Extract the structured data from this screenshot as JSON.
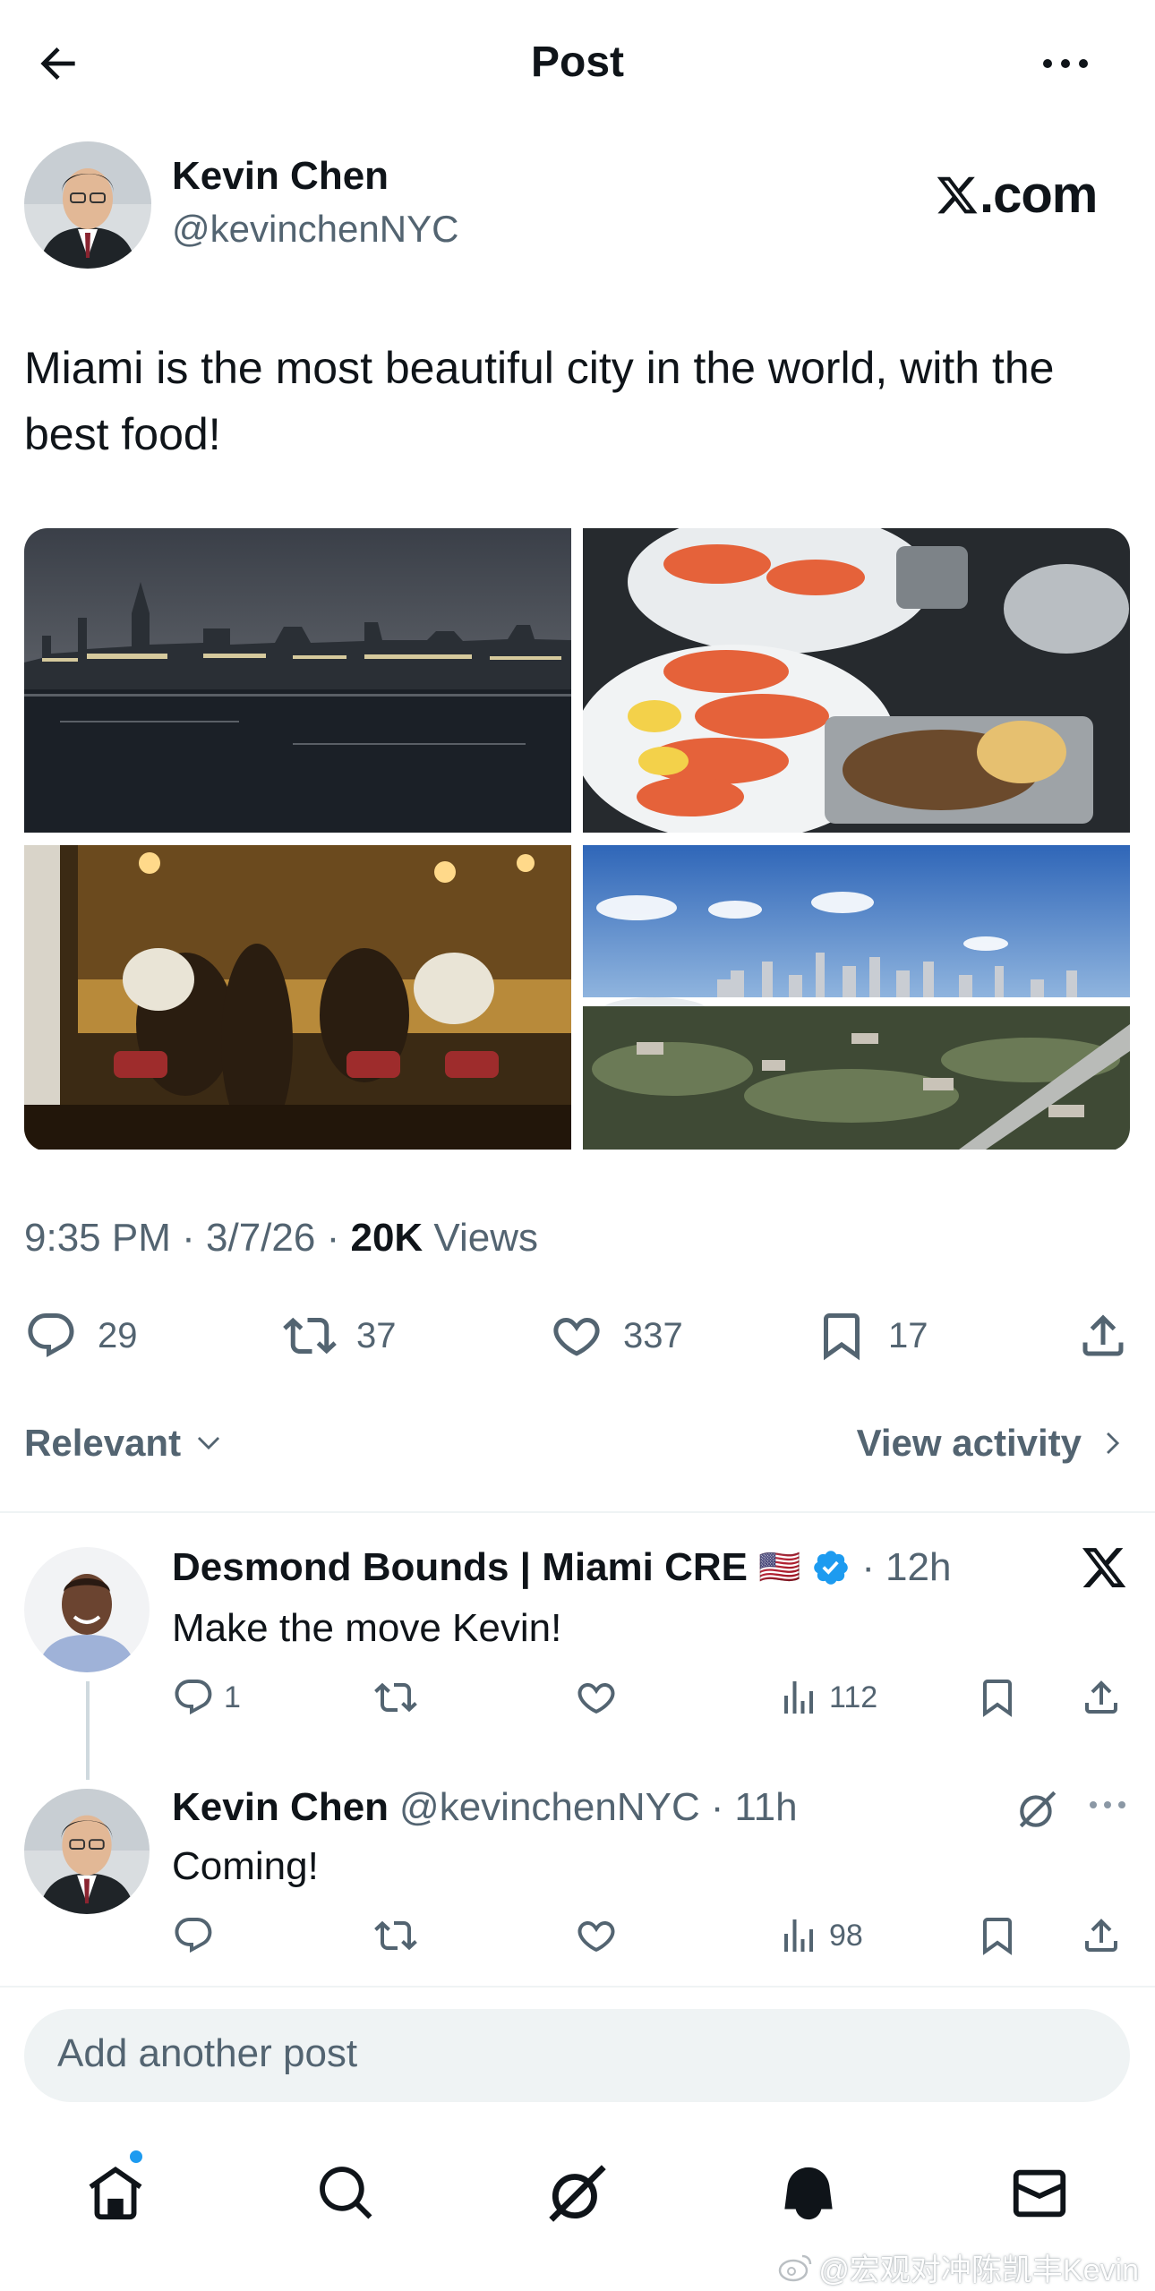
{
  "header": {
    "title": "Post"
  },
  "post": {
    "author_name": "Kevin Chen",
    "author_handle": "@kevinchenNYC",
    "brand_logo_text": ".com",
    "text": "Miami is the most beautiful city in the world, with the best food!",
    "time": "9:35 PM",
    "date": "3/7/26",
    "views_count": "20K",
    "views_label": "Views",
    "separator": "·",
    "stats": {
      "replies": "29",
      "reposts": "37",
      "likes": "337",
      "bookmarks": "17"
    },
    "media": [
      {
        "name": "miami-night-skyline"
      },
      {
        "name": "stone-crab-dinner"
      },
      {
        "name": "restaurant-bar-scene"
      },
      {
        "name": "miami-aerial-view"
      }
    ]
  },
  "sort": {
    "label": "Relevant",
    "activity": "View activity"
  },
  "replies": [
    {
      "name": "Desmond Bounds | Miami CRE",
      "flag": "🇺🇸",
      "time": "12h",
      "text": "Make the move Kevin!",
      "reply_count": "1",
      "views": "112"
    },
    {
      "name": "Kevin Chen",
      "handle": "@kevinchenNYC",
      "time": "11h",
      "text": "Coming!",
      "views": "98"
    }
  ],
  "composer": {
    "placeholder": "Add another post"
  },
  "watermark": "@宏观对冲陈凯丰Kevin",
  "colors": {
    "text": "#0f1419",
    "muted": "#536471",
    "accent": "#1d9bf0",
    "divider": "#eff3f4"
  }
}
